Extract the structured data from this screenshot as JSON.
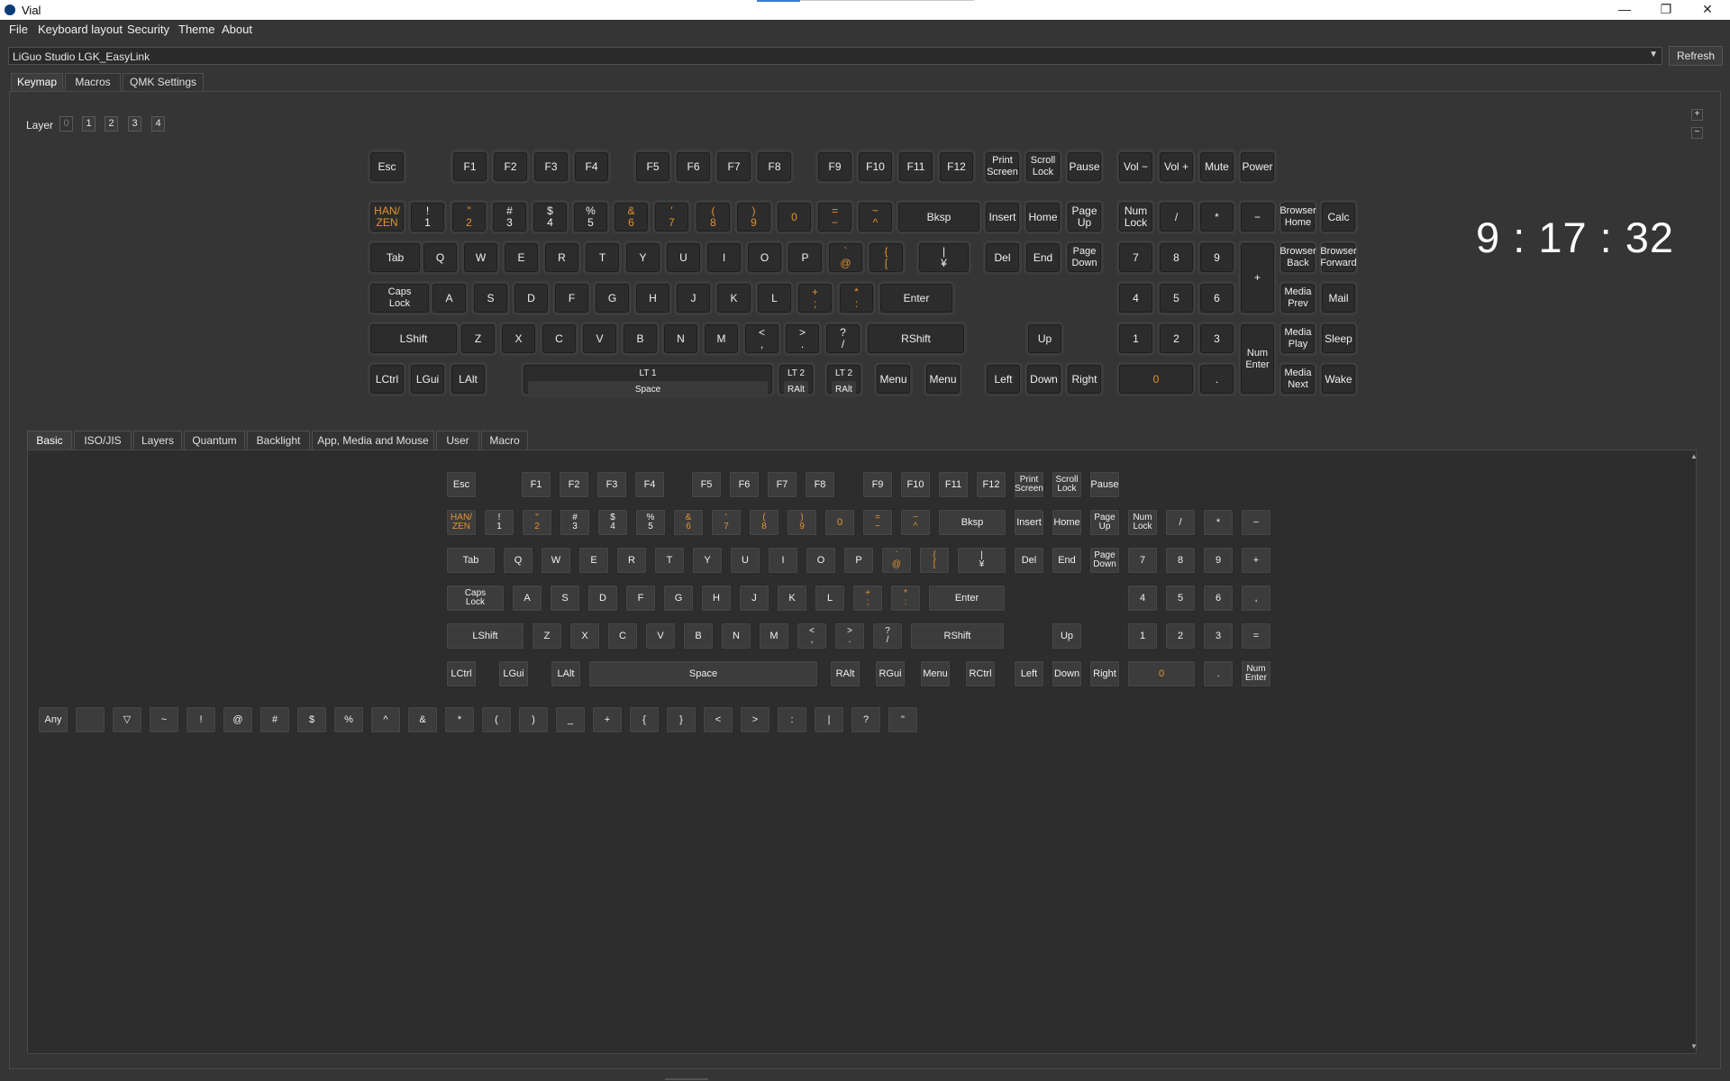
{
  "window": {
    "title": "Vial",
    "minimize": "—",
    "restore": "❐",
    "close": "✕"
  },
  "menu": [
    "File",
    "Keyboard layout",
    "Security",
    "Theme",
    "About"
  ],
  "device": {
    "selected": "LiGuo Studio LGK_EasyLink",
    "refresh_label": "Refresh",
    "dropdown_icon": "▼"
  },
  "tabs": [
    "Keymap",
    "Macros",
    "QMK Settings"
  ],
  "layers": {
    "label": "Layer",
    "items": [
      "0",
      "1",
      "2",
      "3",
      "4"
    ],
    "active": 0
  },
  "zoom": {
    "in": "+",
    "out": "−"
  },
  "clock": "9 : 17 : 32",
  "keymap": {
    "row_f": [
      "Esc",
      "F1",
      "F2",
      "F3",
      "F4",
      "F5",
      "F6",
      "F7",
      "F8",
      "F9",
      "F10",
      "F11",
      "F12",
      "Print\nScreen",
      "Scroll\nLock",
      "Pause",
      "Vol −",
      "Vol +",
      "Mute",
      "Power"
    ],
    "row_1": [
      "HAN/\nZEN",
      "!\n1",
      "\"\n2",
      "#\n3",
      "$\n4",
      "%\n5",
      "&\n6",
      "'\n7",
      "(\n8",
      ")\n9",
      "0",
      "=\n−",
      "~\n^",
      "Bksp",
      "Insert",
      "Home",
      "Page\nUp",
      "Num\nLock",
      "/",
      "*",
      "−",
      "Browser\nHome",
      "Calc"
    ],
    "row_2": [
      "Tab",
      "Q",
      "W",
      "E",
      "R",
      "T",
      "Y",
      "U",
      "I",
      "O",
      "P",
      "`\n@",
      "{\n[",
      "|\n¥",
      "Del",
      "End",
      "Page\nDown",
      "7",
      "8",
      "9",
      "+",
      "Browser\nBack",
      "Browser\nForward"
    ],
    "row_3": [
      "Caps\nLock",
      "A",
      "S",
      "D",
      "F",
      "G",
      "H",
      "J",
      "K",
      "L",
      "+\n;",
      "*\n:",
      "Enter",
      "4",
      "5",
      "6",
      "Media\nPrev",
      "Mail"
    ],
    "row_4": [
      "LShift",
      "Z",
      "X",
      "C",
      "V",
      "B",
      "N",
      "M",
      "<\n,",
      ">\n.",
      "?\n/",
      "RShift",
      "Up",
      "1",
      "2",
      "3",
      "Num\nEnter",
      "Media\nPlay",
      "Sleep"
    ],
    "row_5": [
      "LCtrl",
      "LGui",
      "LAlt",
      "LT 1",
      "LT 2",
      "LT 2",
      "Menu",
      "Menu",
      "Left",
      "Down",
      "Right",
      "0",
      ".",
      "Media\nNext",
      "Wake"
    ],
    "lt_sub": [
      "Space",
      "RAlt",
      "RAlt"
    ]
  },
  "subtabs": [
    "Basic",
    "ISO/JIS",
    "Layers",
    "Quantum",
    "Backlight",
    "App, Media and Mouse",
    "User",
    "Macro"
  ],
  "basic": {
    "row_f": [
      "Esc",
      "F1",
      "F2",
      "F3",
      "F4",
      "F5",
      "F6",
      "F7",
      "F8",
      "F9",
      "F10",
      "F11",
      "F12",
      "Print\nScreen",
      "Scroll\nLock",
      "Pause"
    ],
    "row_1": [
      "HAN/\nZEN",
      "!\n1",
      "\"\n2",
      "#\n3",
      "$\n4",
      "%\n5",
      "&\n6",
      "'\n7",
      "(\n8",
      ")\n9",
      "0",
      "=\n−",
      "~\n^",
      "Bksp",
      "Insert",
      "Home",
      "Page\nUp",
      "Num\nLock",
      "/",
      "*",
      "−"
    ],
    "row_2": [
      "Tab",
      "Q",
      "W",
      "E",
      "R",
      "T",
      "Y",
      "U",
      "I",
      "O",
      "P",
      "`\n@",
      "{\n[",
      "|\n¥",
      "Del",
      "End",
      "Page\nDown",
      "7",
      "8",
      "9",
      "+"
    ],
    "row_3": [
      "Caps\nLock",
      "A",
      "S",
      "D",
      "F",
      "G",
      "H",
      "J",
      "K",
      "L",
      "+\n;",
      "*\n:",
      "Enter",
      "4",
      "5",
      "6",
      ","
    ],
    "row_4": [
      "LShift",
      "Z",
      "X",
      "C",
      "V",
      "B",
      "N",
      "M",
      "<\n,",
      ">\n.",
      "?\n/",
      "RShift",
      "Up",
      "1",
      "2",
      "3",
      "="
    ],
    "row_5": [
      "LCtrl",
      "LGui",
      "LAlt",
      "Space",
      "RAlt",
      "RGui",
      "Menu",
      "RCtrl",
      "Left",
      "Down",
      "Right",
      "0",
      ".",
      "Num\nEnter"
    ],
    "symbols": [
      "Any",
      "",
      "▽",
      "~",
      "!",
      "@",
      "#",
      "$",
      "%",
      "^",
      "&",
      "*",
      "(",
      ")",
      "_",
      "+",
      "{",
      "}",
      "<",
      ">",
      ":",
      "|",
      "?",
      "\""
    ]
  },
  "colors": {
    "background": "#353535",
    "key": "#2c2c2c",
    "orange_legend": "#e4932f"
  }
}
